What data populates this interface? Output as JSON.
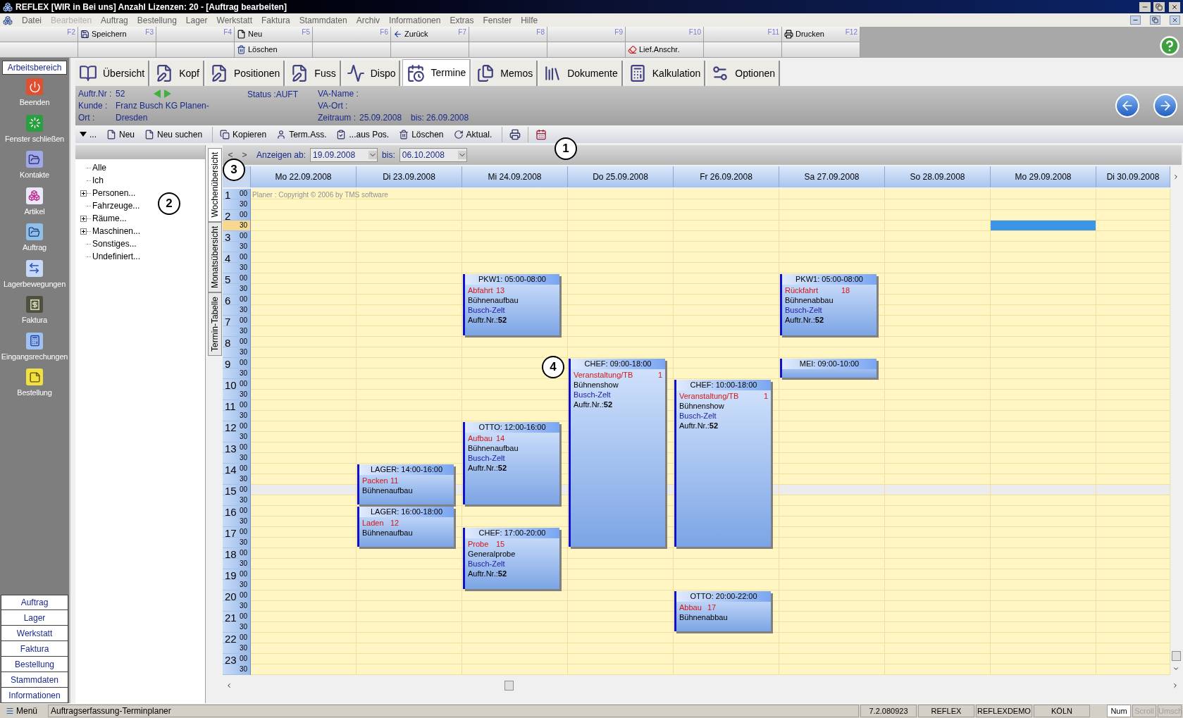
{
  "window": {
    "title": "REFLEX [WIR in Bei uns] Anzahl Lizenzen: 20 - [Auftrag bearbeiten]"
  },
  "menu": [
    {
      "label": "Datei",
      "disabled": false
    },
    {
      "label": "Bearbeiten",
      "disabled": true
    },
    {
      "label": "Auftrag",
      "disabled": false
    },
    {
      "label": "Bestellung",
      "disabled": false
    },
    {
      "label": "Lager",
      "disabled": false
    },
    {
      "label": "Werkstatt",
      "disabled": false
    },
    {
      "label": "Faktura",
      "disabled": false
    },
    {
      "label": "Stammdaten",
      "disabled": false
    },
    {
      "label": "Archiv",
      "disabled": false
    },
    {
      "label": "Informationen",
      "disabled": false
    },
    {
      "label": "Extras",
      "disabled": false
    },
    {
      "label": "Fenster",
      "disabled": false
    },
    {
      "label": "Hilfe",
      "disabled": false
    }
  ],
  "function_keys": [
    {
      "key": "F2"
    },
    {
      "label": "Speichern",
      "key": "F3"
    },
    {
      "key": "F4"
    },
    {
      "label": "Neu",
      "key": "F5",
      "lower_label": "Löschen"
    },
    {
      "key": "F6"
    },
    {
      "label": "Zurück",
      "key": "F7"
    },
    {
      "key": "F8"
    },
    {
      "key": "F9"
    },
    {
      "key": "F10",
      "lower_label": "Lief.Anschr."
    },
    {
      "key": "F11"
    },
    {
      "label": "Drucken",
      "key": "F12"
    }
  ],
  "sidebar": {
    "title": "Arbeitsbereich",
    "items": [
      "Beenden",
      "Fenster schließen",
      "Kontakte",
      "Artikel",
      "Auftrag",
      "Lagerbewegungen",
      "Faktura",
      "Eingangsrechungen",
      "Bestellung"
    ],
    "sections": [
      "Auftrag",
      "Lager",
      "Werkstatt",
      "Faktura",
      "Bestellung",
      "Stammdaten",
      "Informationen"
    ]
  },
  "tabs": [
    {
      "label": "Übersicht",
      "selected": false
    },
    {
      "label": "Kopf",
      "selected": false
    },
    {
      "label": "Positionen",
      "selected": false
    },
    {
      "label": "Fuss",
      "selected": false
    },
    {
      "label": "Dispo",
      "selected": false
    },
    {
      "label": "Termine",
      "selected": true
    },
    {
      "label": "Memos",
      "selected": false
    },
    {
      "label": "Dokumente",
      "selected": false
    },
    {
      "label": "Kalkulation",
      "selected": false
    },
    {
      "label": "Optionen",
      "selected": false
    }
  ],
  "order": {
    "number_label": "Auftr.Nr :",
    "number": "52",
    "customer_label": "Kunde :",
    "customer": "Franz Busch KG Planen-",
    "city_label": "Ort :",
    "city": "Dresden",
    "status": "Status :AUFT",
    "event_name_label": "VA-Name :",
    "event_place_label": "VA-Ort :",
    "period_label": "Zeitraum :",
    "period_from": "25.09.2008",
    "period_to": "bis: 26.09.2008"
  },
  "toolbar": [
    "...",
    "Neu",
    "Neu suchen",
    "Kopieren",
    "Term.Ass.",
    "...aus Pos.",
    "Löschen",
    "Aktual."
  ],
  "tree": [
    {
      "label": "Alle",
      "kind": "leaf"
    },
    {
      "label": "Ich",
      "kind": "leaf"
    },
    {
      "label": "Personen...",
      "kind": "group",
      "expanded": false
    },
    {
      "label": "Fahrzeuge...",
      "kind": "leaf"
    },
    {
      "label": "Räume...",
      "kind": "group",
      "expanded": false
    },
    {
      "label": "Maschinen...",
      "kind": "group",
      "expanded": false
    },
    {
      "label": "Sonstiges...",
      "kind": "leaf"
    },
    {
      "label": "Undefiniert...",
      "kind": "leaf"
    }
  ],
  "views": [
    {
      "label": "Wochenübersicht",
      "selected": true
    },
    {
      "label": "Monatsübersicht",
      "selected": false
    },
    {
      "label": "Termin-Tabelle",
      "selected": false
    }
  ],
  "range": {
    "prev": "<",
    "next": ">",
    "from_label": "Anzeigen ab:",
    "from": "19.09.2008",
    "to_label": "bis:",
    "to": "06.10.2008"
  },
  "copyright": "Planer : Copyright © 2006 by TMS software",
  "times": [
    {
      "hour": "1",
      "slots": [
        {
          "label": "00",
          "selected": false,
          "current": false
        },
        {
          "label": "30",
          "selected": false,
          "current": false
        }
      ]
    },
    {
      "hour": "2",
      "slots": [
        {
          "label": "00",
          "selected": false,
          "current": false
        },
        {
          "label": "30",
          "selected": true,
          "current": false
        }
      ]
    },
    {
      "hour": "3",
      "slots": [
        {
          "label": "00",
          "selected": false,
          "current": false
        },
        {
          "label": "30",
          "selected": false,
          "current": false
        }
      ]
    },
    {
      "hour": "4",
      "slots": [
        {
          "label": "00",
          "selected": false,
          "current": false
        },
        {
          "label": "30",
          "selected": false,
          "current": false
        }
      ]
    },
    {
      "hour": "5",
      "slots": [
        {
          "label": "00",
          "selected": false,
          "current": false
        },
        {
          "label": "30",
          "selected": false,
          "current": false
        }
      ]
    },
    {
      "hour": "6",
      "slots": [
        {
          "label": "00",
          "selected": false,
          "current": false
        },
        {
          "label": "30",
          "selected": false,
          "current": false
        }
      ]
    },
    {
      "hour": "7",
      "slots": [
        {
          "label": "00",
          "selected": false,
          "current": false
        },
        {
          "label": "30",
          "selected": false,
          "current": false
        }
      ]
    },
    {
      "hour": "8",
      "slots": [
        {
          "label": "00",
          "selected": false,
          "current": false
        },
        {
          "label": "30",
          "selected": false,
          "current": false
        }
      ]
    },
    {
      "hour": "9",
      "slots": [
        {
          "label": "00",
          "selected": false,
          "current": false
        },
        {
          "label": "30",
          "selected": false,
          "current": false
        }
      ]
    },
    {
      "hour": "10",
      "slots": [
        {
          "label": "00",
          "selected": false,
          "current": false
        },
        {
          "label": "30",
          "selected": false,
          "current": false
        }
      ]
    },
    {
      "hour": "11",
      "slots": [
        {
          "label": "00",
          "selected": false,
          "current": false
        },
        {
          "label": "30",
          "selected": false,
          "current": false
        }
      ]
    },
    {
      "hour": "12",
      "slots": [
        {
          "label": "00",
          "selected": false,
          "current": false
        },
        {
          "label": "30",
          "selected": false,
          "current": false
        }
      ]
    },
    {
      "hour": "13",
      "slots": [
        {
          "label": "00",
          "selected": false,
          "current": false
        },
        {
          "label": "30",
          "selected": false,
          "current": false
        }
      ]
    },
    {
      "hour": "14",
      "slots": [
        {
          "label": "00",
          "selected": false,
          "current": false
        },
        {
          "label": "30",
          "selected": false,
          "current": false
        }
      ]
    },
    {
      "hour": "15",
      "slots": [
        {
          "label": "00",
          "selected": false,
          "current": true
        },
        {
          "label": "30",
          "selected": false,
          "current": false
        }
      ]
    },
    {
      "hour": "16",
      "slots": [
        {
          "label": "00",
          "selected": false,
          "current": false
        },
        {
          "label": "30",
          "selected": false,
          "current": false
        }
      ]
    },
    {
      "hour": "17",
      "slots": [
        {
          "label": "00",
          "selected": false,
          "current": false
        },
        {
          "label": "30",
          "selected": false,
          "current": false
        }
      ]
    },
    {
      "hour": "18",
      "slots": [
        {
          "label": "00",
          "selected": false,
          "current": false
        },
        {
          "label": "30",
          "selected": false,
          "current": false
        }
      ]
    },
    {
      "hour": "19",
      "slots": [
        {
          "label": "00",
          "selected": false,
          "current": false
        },
        {
          "label": "30",
          "selected": false,
          "current": false
        }
      ]
    },
    {
      "hour": "20",
      "slots": [
        {
          "label": "00",
          "selected": false,
          "current": false
        },
        {
          "label": "30",
          "selected": false,
          "current": false
        }
      ]
    },
    {
      "hour": "21",
      "slots": [
        {
          "label": "00",
          "selected": false,
          "current": false
        },
        {
          "label": "30",
          "selected": false,
          "current": false
        }
      ]
    },
    {
      "hour": "22",
      "slots": [
        {
          "label": "00",
          "selected": false,
          "current": false
        },
        {
          "label": "30",
          "selected": false,
          "current": false
        }
      ]
    },
    {
      "hour": "23",
      "slots": [
        {
          "label": "00",
          "selected": false,
          "current": false
        },
        {
          "label": "30",
          "selected": false,
          "current": false
        }
      ]
    }
  ],
  "days": [
    {
      "label": "Mo 22.09.2008",
      "selected": false
    },
    {
      "label": "Di 23.09.2008",
      "selected": false,
      "events": [
        {
          "title": "LAGER: 14:00-16:00",
          "lines": [
            {
              "kind": "task",
              "text": "Packen",
              "number": "11"
            },
            {
              "kind": "plain",
              "text": "Bühnenaufbau"
            }
          ]
        },
        {
          "title": "LAGER: 16:00-18:00",
          "lines": [
            {
              "kind": "task",
              "text": "Laden",
              "number": "12"
            },
            {
              "kind": "plain",
              "text": "Bühnenaufbau"
            }
          ]
        }
      ]
    },
    {
      "label": "Mi 24.09.2008",
      "selected": false,
      "events": [
        {
          "title": "PKW1: 05:00-08:00",
          "lines": [
            {
              "kind": "task",
              "text": "Abfahrt",
              "number": "13"
            },
            {
              "kind": "plain",
              "text": "Bühnenaufbau"
            },
            {
              "kind": "project",
              "text": "Busch-Zelt"
            },
            {
              "kind": "order",
              "text": "Auftr.Nr.:**52**"
            }
          ]
        },
        {
          "title": "OTTO: 12:00-16:00",
          "lines": [
            {
              "kind": "task",
              "text": "Aufbau",
              "number": "14"
            },
            {
              "kind": "plain",
              "text": "Bühnenaufbau"
            },
            {
              "kind": "project",
              "text": "Busch-Zelt"
            },
            {
              "kind": "order",
              "text": "Auftr.Nr.:**52**"
            }
          ]
        },
        {
          "title": "CHEF: 17:00-20:00",
          "lines": [
            {
              "kind": "task",
              "text": "Probe",
              "number": "15"
            },
            {
              "kind": "plain",
              "text": "Generalprobe"
            },
            {
              "kind": "project",
              "text": "Busch-Zelt"
            },
            {
              "kind": "order",
              "text": "Auftr.Nr.:**52**"
            }
          ]
        }
      ]
    },
    {
      "label": "Do 25.09.2008",
      "selected": false,
      "events": [
        {
          "title": "CHEF: 09:00-18:00",
          "lines": [
            {
              "kind": "task",
              "text": "Veranstaltung/TB",
              "number": "1"
            },
            {
              "kind": "plain",
              "text": "Bühnenshow"
            },
            {
              "kind": "project",
              "text": "Busch-Zelt"
            },
            {
              "kind": "order",
              "text": "Auftr.Nr.:**52**"
            }
          ]
        }
      ]
    },
    {
      "label": "Fr 26.09.2008",
      "selected": false,
      "events": [
        {
          "title": "CHEF: 10:00-18:00",
          "lines": [
            {
              "kind": "task",
              "text": "Veranstaltung/TB",
              "number": "1"
            },
            {
              "kind": "plain",
              "text": "Bühnenshow"
            },
            {
              "kind": "project",
              "text": "Busch-Zelt"
            },
            {
              "kind": "order",
              "text": "Auftr.Nr.:**52**"
            }
          ]
        },
        {
          "title": "OTTO: 20:00-22:00",
          "lines": [
            {
              "kind": "task",
              "text": "Abbau",
              "number": "17"
            },
            {
              "kind": "plain",
              "text": "Bühnenabbau"
            }
          ]
        }
      ]
    },
    {
      "label": "Sa 27.09.2008",
      "selected": false,
      "events": [
        {
          "title": "PKW1: 05:00-08:00",
          "lines": [
            {
              "kind": "task",
              "text": "Rückfahrt",
              "number": "18"
            },
            {
              "kind": "plain",
              "text": "Bühnenabbau"
            },
            {
              "kind": "project",
              "text": "Busch-Zelt"
            },
            {
              "kind": "order",
              "text": "Auftr.Nr.:**52**"
            }
          ]
        },
        {
          "title": "MEI: 09:00-10:00"
        }
      ]
    },
    {
      "label": "So 28.09.2008",
      "selected": false
    },
    {
      "label": "Mo 29.09.2008",
      "selected": true
    },
    {
      "label": "Di 30.09.2008",
      "selected": false
    }
  ],
  "annotations": [
    "1",
    "2",
    "3",
    "4"
  ],
  "status_bar": {
    "menu": "Menü",
    "message": "Auftragserfassung-Terminplaner",
    "fields": [
      "7.2.080923",
      "REFLEX",
      "REFLEXDEMO",
      "KÖLN"
    ],
    "keys": [
      {
        "label": "Num",
        "on": true
      },
      {
        "label": "Scroll",
        "on": false
      },
      {
        "label": "Umsch",
        "on": false
      }
    ]
  }
}
